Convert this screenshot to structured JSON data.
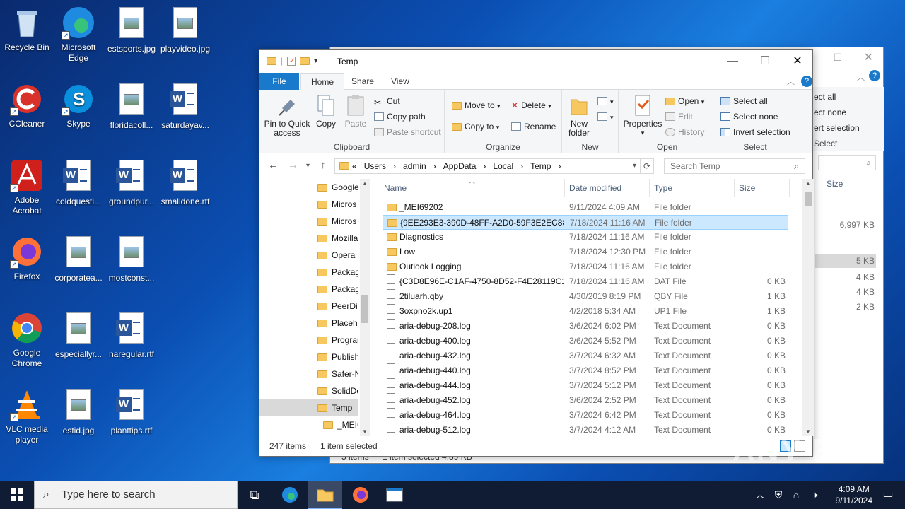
{
  "desktop": {
    "icons": [
      {
        "label": "Recycle Bin"
      },
      {
        "label": "Microsoft Edge"
      },
      {
        "label": "estsports.jpg"
      },
      {
        "label": "playvideo.jpg"
      },
      {
        "label": "CCleaner"
      },
      {
        "label": "Skype"
      },
      {
        "label": "floridacoll..."
      },
      {
        "label": "saturdayav..."
      },
      {
        "label": "Adobe Acrobat"
      },
      {
        "label": "coldquesti..."
      },
      {
        "label": "groundpur..."
      },
      {
        "label": "smalldone.rtf"
      },
      {
        "label": "Firefox"
      },
      {
        "label": "corporatea..."
      },
      {
        "label": "mostconst..."
      },
      {
        "label": "Google Chrome"
      },
      {
        "label": "especiallyr..."
      },
      {
        "label": "naregular.rtf"
      },
      {
        "label": "VLC media player"
      },
      {
        "label": "estid.jpg"
      },
      {
        "label": "planttips.rtf"
      }
    ]
  },
  "bg_window": {
    "ribbon": [
      "ect all",
      "ect none",
      "ert selection",
      "Select"
    ],
    "size_header": "Size",
    "sizes": [
      "6,997 KB",
      "5 KB",
      "4 KB",
      "4 KB",
      "2 KB"
    ],
    "status": "5 items",
    "status_sel": "1 item selected  4.89 KB"
  },
  "window": {
    "title": "Temp",
    "tabs": {
      "file": "File",
      "home": "Home",
      "share": "Share",
      "view": "View"
    },
    "clipboard": {
      "pin": "Pin to Quick access",
      "copy": "Copy",
      "paste": "Paste",
      "cut": "Cut",
      "copy_path": "Copy path",
      "paste_shortcut": "Paste shortcut",
      "label": "Clipboard"
    },
    "organize": {
      "move_to": "Move to",
      "copy_to": "Copy to",
      "delete": "Delete",
      "rename": "Rename",
      "label": "Organize"
    },
    "new": {
      "new_folder": "New folder",
      "label": "New"
    },
    "open": {
      "properties": "Properties",
      "open": "Open",
      "edit": "Edit",
      "history": "History",
      "label": "Open"
    },
    "select": {
      "select_all": "Select all",
      "select_none": "Select none",
      "invert": "Invert selection",
      "label": "Select"
    },
    "address": [
      "«",
      "Users",
      "›",
      "admin",
      "›",
      "AppData",
      "›",
      "Local",
      "›",
      "Temp",
      "›"
    ],
    "search_placeholder": "Search Temp",
    "nav_items": [
      "Google",
      "Micros",
      "Micros",
      "Mozilla",
      "Opera",
      "Packag",
      "Packag",
      "PeerDis",
      "Placeh",
      "Progran",
      "Publish",
      "Safer-N",
      "SolidDo",
      "Temp",
      "_MEI6"
    ],
    "columns": {
      "name": "Name",
      "date": "Date modified",
      "type": "Type",
      "size": "Size"
    },
    "files": [
      {
        "name": "_MEI69202",
        "date": "9/11/2024 4:09 AM",
        "type": "File folder",
        "size": "",
        "kind": "folder"
      },
      {
        "name": "{9EE293E3-390D-48FF-A2D0-59F3E2EC88...",
        "date": "7/18/2024 11:16 AM",
        "type": "File folder",
        "size": "",
        "kind": "folder"
      },
      {
        "name": "Diagnostics",
        "date": "7/18/2024 11:16 AM",
        "type": "File folder",
        "size": "",
        "kind": "folder"
      },
      {
        "name": "Low",
        "date": "7/18/2024 12:30 PM",
        "type": "File folder",
        "size": "",
        "kind": "folder"
      },
      {
        "name": "Outlook Logging",
        "date": "7/18/2024 11:16 AM",
        "type": "File folder",
        "size": "",
        "kind": "folder"
      },
      {
        "name": "{C3D8E96E-C1AF-4750-8D52-F4E28119C1...",
        "date": "7/18/2024 11:16 AM",
        "type": "DAT File",
        "size": "0 KB",
        "kind": "doc"
      },
      {
        "name": "2tiluarh.qby",
        "date": "4/30/2019 8:19 PM",
        "type": "QBY File",
        "size": "1 KB",
        "kind": "doc"
      },
      {
        "name": "3oxpno2k.up1",
        "date": "4/2/2018 5:34 AM",
        "type": "UP1 File",
        "size": "1 KB",
        "kind": "doc"
      },
      {
        "name": "aria-debug-208.log",
        "date": "3/6/2024 6:02 PM",
        "type": "Text Document",
        "size": "0 KB",
        "kind": "txt"
      },
      {
        "name": "aria-debug-400.log",
        "date": "3/6/2024 5:52 PM",
        "type": "Text Document",
        "size": "0 KB",
        "kind": "txt"
      },
      {
        "name": "aria-debug-432.log",
        "date": "3/7/2024 6:32 AM",
        "type": "Text Document",
        "size": "0 KB",
        "kind": "txt"
      },
      {
        "name": "aria-debug-440.log",
        "date": "3/7/2024 8:52 PM",
        "type": "Text Document",
        "size": "0 KB",
        "kind": "txt"
      },
      {
        "name": "aria-debug-444.log",
        "date": "3/7/2024 5:12 PM",
        "type": "Text Document",
        "size": "0 KB",
        "kind": "txt"
      },
      {
        "name": "aria-debug-452.log",
        "date": "3/6/2024 2:52 PM",
        "type": "Text Document",
        "size": "0 KB",
        "kind": "txt"
      },
      {
        "name": "aria-debug-464.log",
        "date": "3/7/2024 6:42 PM",
        "type": "Text Document",
        "size": "0 KB",
        "kind": "txt"
      },
      {
        "name": "aria-debug-512.log",
        "date": "3/7/2024 4:12 AM",
        "type": "Text Document",
        "size": "0 KB",
        "kind": "txt"
      }
    ],
    "status_count": "247 items",
    "status_selected": "1 item selected"
  },
  "taskbar": {
    "search_placeholder": "Type here to search",
    "time": "4:09 AM",
    "date": "9/11/2024"
  },
  "watermark": "ANY RUN"
}
